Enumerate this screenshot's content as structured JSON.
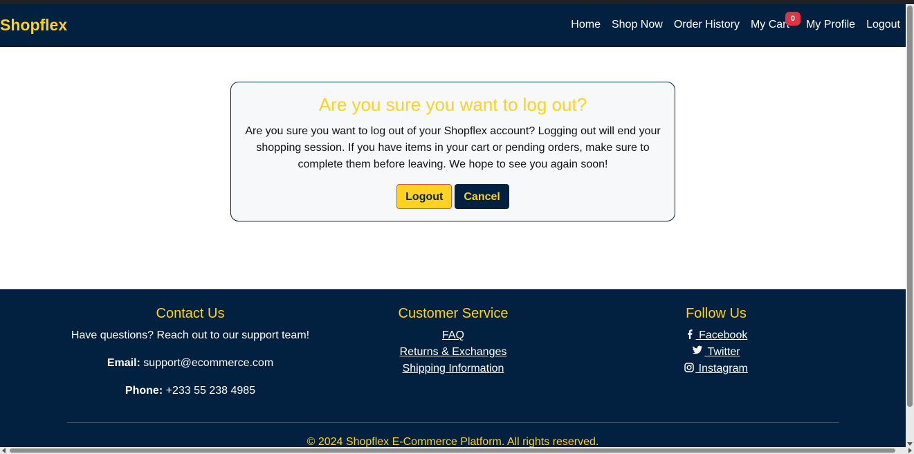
{
  "nav": {
    "brand": "Shopflex",
    "links": [
      "Home",
      "Shop Now",
      "Order History",
      "My Cart",
      "My Profile",
      "Logout"
    ],
    "cart_count": "0"
  },
  "dialog": {
    "title": "Are you sure you want to log out?",
    "message": "Are you sure you want to log out of your Shopflex account? Logging out will end your shopping session. If you have items in your cart or pending orders, make sure to complete them before leaving. We hope to see you again soon!",
    "logout_label": "Logout",
    "cancel_label": "Cancel"
  },
  "footer": {
    "contact": {
      "heading": "Contact Us",
      "tagline": "Have questions? Reach out to our support team!",
      "email_label": "Email:",
      "email": "support@ecommerce.com",
      "phone_label": "Phone:",
      "phone": "+233 55 238 4985"
    },
    "service": {
      "heading": "Customer Service",
      "links": [
        "FAQ",
        "Returns & Exchanges",
        "Shipping Information"
      ]
    },
    "follow": {
      "heading": "Follow Us",
      "links": [
        {
          "label": " Facebook",
          "icon": "facebook-icon"
        },
        {
          "label": " Twitter",
          "icon": "twitter-icon"
        },
        {
          "label": " Instagram",
          "icon": "instagram-icon"
        }
      ]
    },
    "copyright": "© 2024 Shopflex E-Commerce Platform. All rights reserved."
  },
  "colors": {
    "navy": "#02203f",
    "accent": "#ffd21f",
    "badge": "#dc3545"
  }
}
